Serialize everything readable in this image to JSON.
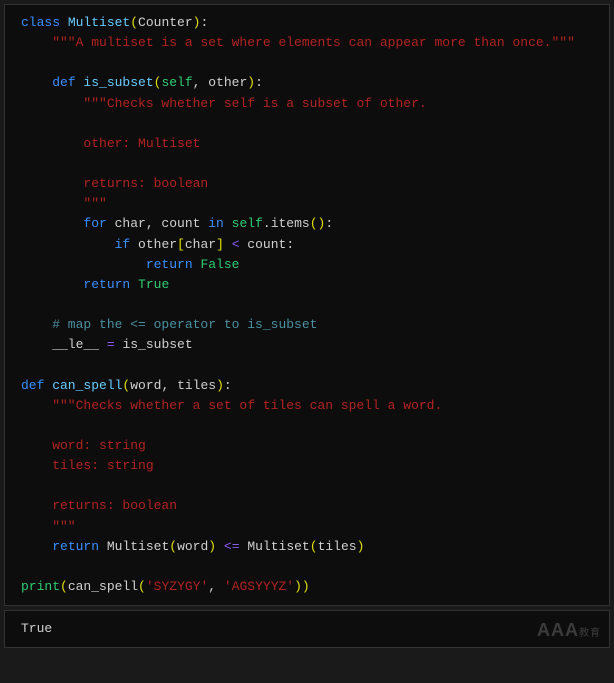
{
  "code": {
    "line1_kw": "class",
    "line1_name": " Multiset",
    "line1_paren_open": "(",
    "line1_base": "Counter",
    "line1_paren_close": ")",
    "line1_colon": ":",
    "line2_doc": "    \"\"\"A multiset is a set where elements can appear more than once.\"\"\"",
    "line3_blank": "",
    "line4_indent": "    ",
    "line4_def": "def",
    "line4_name": " is_subset",
    "line4_paren_open": "(",
    "line4_self": "self",
    "line4_comma": ", ",
    "line4_arg": "other",
    "line4_paren_close": ")",
    "line4_colon": ":",
    "line5_doc": "        \"\"\"Checks whether self is a subset of other.",
    "line6_blank": "",
    "line7_doc": "        other: Multiset",
    "line8_blank": "",
    "line9_doc": "        returns: boolean",
    "line10_doc": "        \"\"\"",
    "line11_indent": "        ",
    "line11_for": "for",
    "line11_vars": " char, count ",
    "line11_in": "in",
    "line11_self": " self",
    "line11_dot": ".",
    "line11_items": "items",
    "line11_paren": "()",
    "line11_colon": ":",
    "line12_indent": "            ",
    "line12_if": "if",
    "line12_expr1": " other",
    "line12_bracket_open": "[",
    "line12_char": "char",
    "line12_bracket_close": "]",
    "line12_op": " < ",
    "line12_count": "count",
    "line12_colon": ":",
    "line13_indent": "                ",
    "line13_return": "return",
    "line13_false": " False",
    "line14_indent": "        ",
    "line14_return": "return",
    "line14_true": " True",
    "line15_blank": "",
    "line16_comment": "    # map the <= operator to is_subset",
    "line17_indent": "    ",
    "line17_le": "__le__",
    "line17_eq": " = ",
    "line17_val": "is_subset",
    "line18_blank": "",
    "line19_def": "def",
    "line19_name": " can_spell",
    "line19_paren_open": "(",
    "line19_arg1": "word",
    "line19_comma": ", ",
    "line19_arg2": "tiles",
    "line19_paren_close": ")",
    "line19_colon": ":",
    "line20_doc": "    \"\"\"Checks whether a set of tiles can spell a word.",
    "line21_blank": "",
    "line22_doc": "    word: string",
    "line23_doc": "    tiles: string",
    "line24_blank": "",
    "line25_doc": "    returns: boolean",
    "line26_doc": "    \"\"\"",
    "line27_indent": "    ",
    "line27_return": "return",
    "line27_sp": " ",
    "line27_ms1": "Multiset",
    "line27_p1o": "(",
    "line27_word": "word",
    "line27_p1c": ")",
    "line27_op": " <= ",
    "line27_ms2": "Multiset",
    "line27_p2o": "(",
    "line27_tiles": "tiles",
    "line27_p2c": ")",
    "line28_blank": "",
    "line29_print": "print",
    "line29_p1o": "(",
    "line29_can": "can_spell",
    "line29_p2o": "(",
    "line29_str1": "'SYZYGY'",
    "line29_comma": ", ",
    "line29_str2": "'AGSYYYZ'",
    "line29_p2c": ")",
    "line29_p1c": ")"
  },
  "output": {
    "result": "True"
  },
  "watermark": {
    "main": "AAA",
    "sub": "教育"
  }
}
